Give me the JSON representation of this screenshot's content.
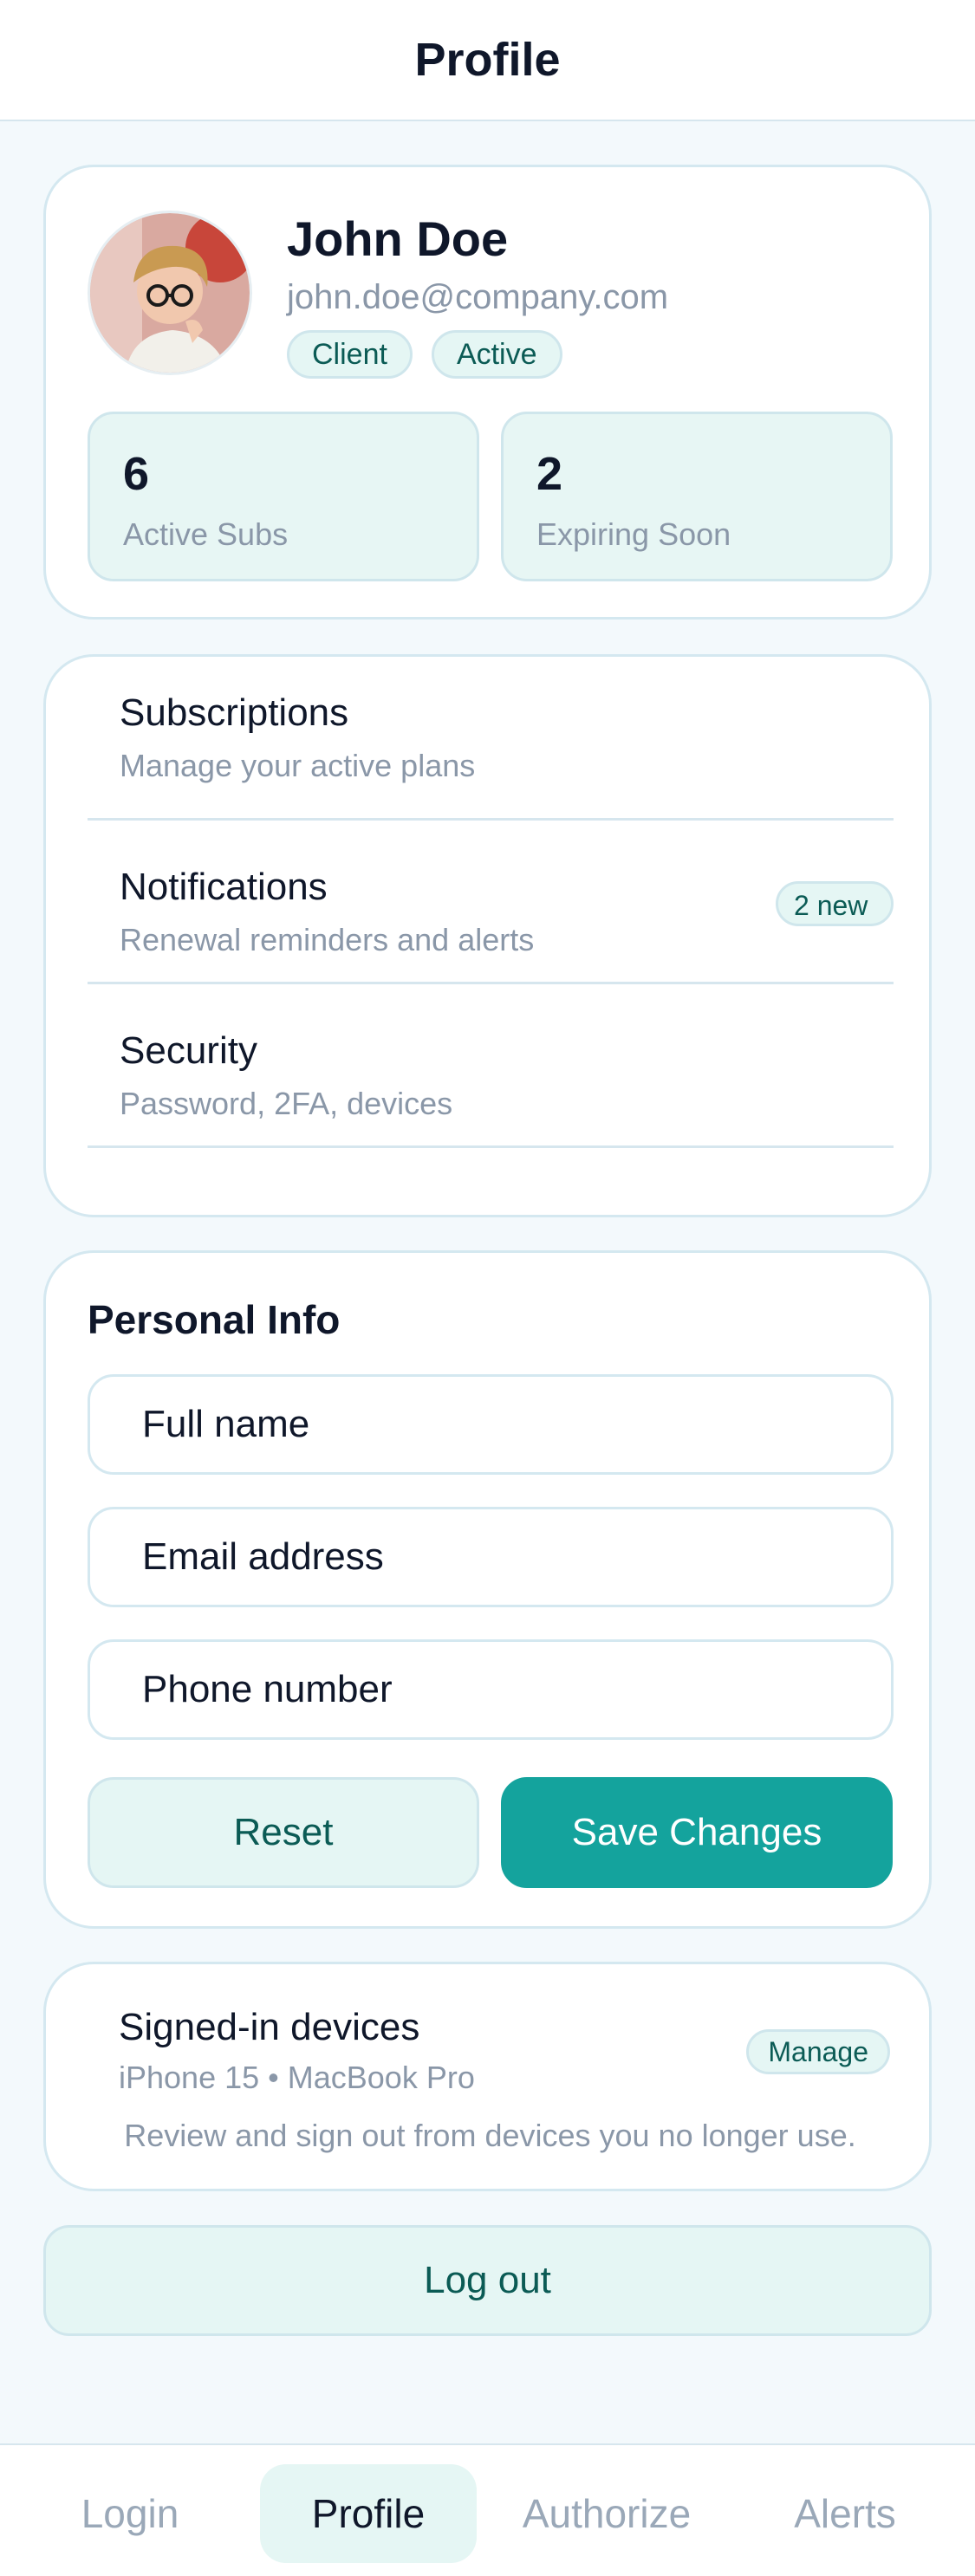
{
  "header": {
    "title": "Profile"
  },
  "profile": {
    "name": "John Doe",
    "email": "john.doe@company.com",
    "badges": [
      "Client",
      "Active"
    ],
    "stats": [
      {
        "value": "6",
        "label": "Active Subs"
      },
      {
        "value": "2",
        "label": "Expiring Soon"
      }
    ]
  },
  "menu": {
    "items": [
      {
        "title": "Subscriptions",
        "subtitle": "Manage your active plans"
      },
      {
        "title": "Notifications",
        "subtitle": "Renewal reminders and alerts",
        "badge": "2 new"
      },
      {
        "title": "Security",
        "subtitle": "Password, 2FA, devices"
      }
    ]
  },
  "personal_info": {
    "title": "Personal Info",
    "fields": [
      {
        "placeholder": "Full name",
        "value": ""
      },
      {
        "placeholder": "Email address",
        "value": ""
      },
      {
        "placeholder": "Phone number",
        "value": ""
      }
    ],
    "reset_label": "Reset",
    "save_label": "Save Changes"
  },
  "devices": {
    "title": "Signed-in devices",
    "list": "iPhone 15 • MacBook Pro",
    "description": "Review and sign out from devices you no longer use.",
    "manage_label": "Manage"
  },
  "logout_label": "Log out",
  "bottom_nav": {
    "items": [
      "Login",
      "Profile",
      "Authorize",
      "Alerts"
    ],
    "active": "Profile"
  },
  "colors": {
    "accent": "#14a39d",
    "accent_soft": "#e5f6f4",
    "text_primary": "#0f172a",
    "text_muted": "#8a97a8"
  },
  "icons": {
    "avatar": "user-avatar-photo"
  }
}
